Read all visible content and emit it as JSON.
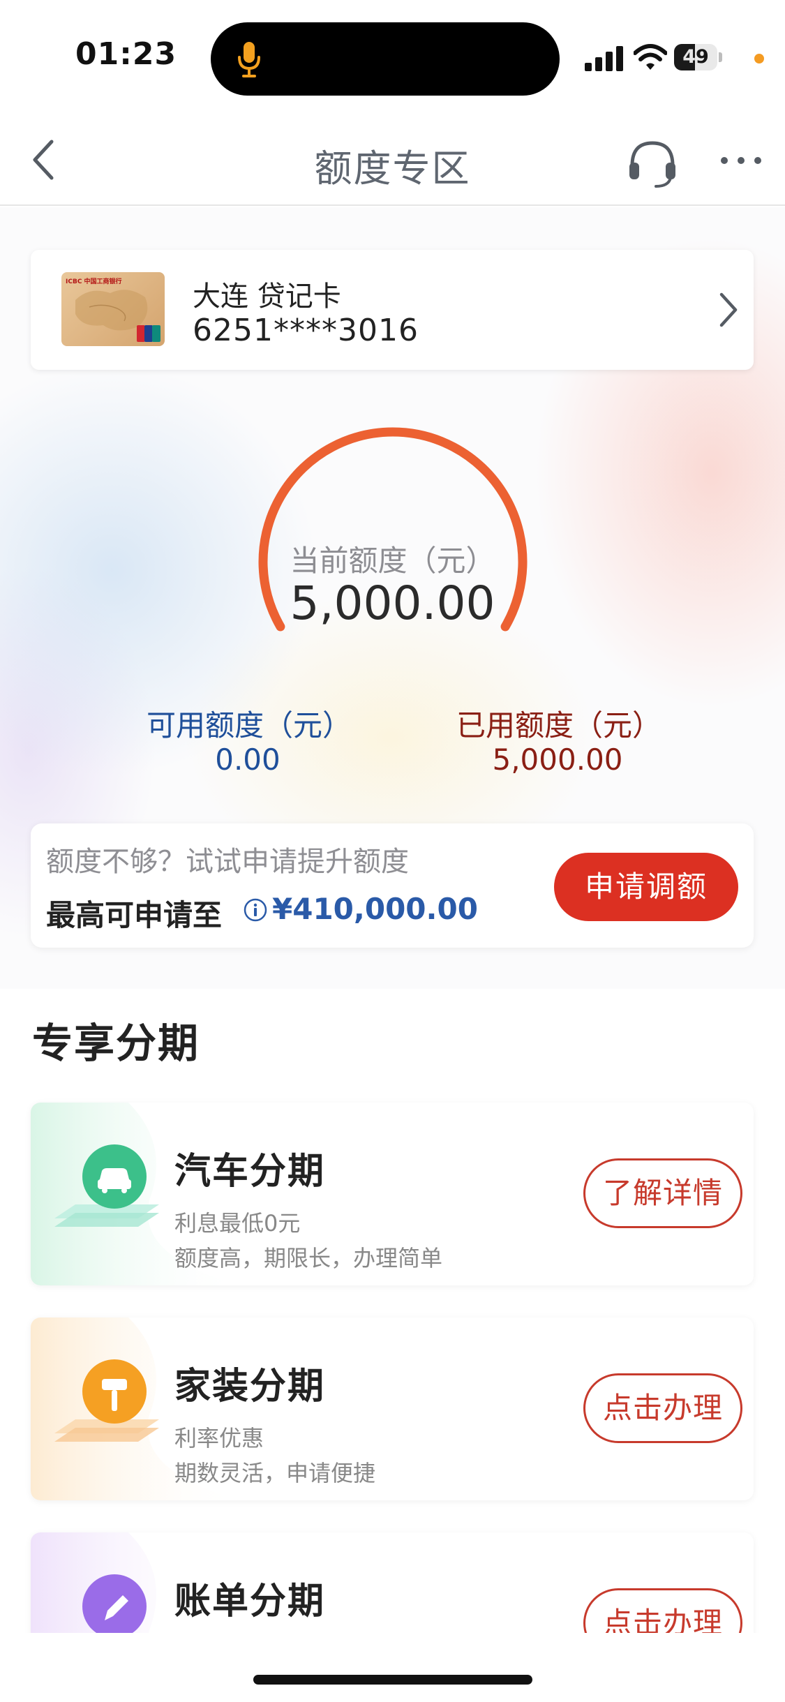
{
  "status_bar": {
    "time": "01:23",
    "battery": "49",
    "battery_level": 0.49,
    "icons": [
      "microphone-icon",
      "signal-icon",
      "wifi-icon",
      "battery-icon"
    ]
  },
  "nav": {
    "title": "额度专区",
    "icons": [
      "back-icon",
      "headset-icon",
      "more-icon"
    ]
  },
  "card": {
    "name": "大连 贷记卡",
    "number": "6251****3016",
    "brand_text": "ICBC 中国工商银行"
  },
  "credit": {
    "current_label": "当前额度（元）",
    "current_value": "5,000.00",
    "available_label": "可用额度（元）",
    "available_value": "0.00",
    "used_label": "已用额度（元）",
    "used_value": "5,000.00",
    "used_fraction": 1.0
  },
  "apply": {
    "prompt": "额度不够？试试申请提升额度",
    "max_label": "最高可申请至",
    "max_value": "¥410,000.00",
    "button": "申请调额"
  },
  "section": {
    "title": "专享分期"
  },
  "products": [
    {
      "title": "汽车分期",
      "line1": "利息最低0元",
      "line2": "额度高，期限长，办理简单",
      "button": "了解详情",
      "icon": "car-icon",
      "color": "#3cc08a"
    },
    {
      "title": "家装分期",
      "line1": "利率优惠",
      "line2": "期数灵活，申请便捷",
      "button": "点击办理",
      "icon": "paint-roller-icon",
      "color": "#f5a023"
    },
    {
      "title": "账单分期",
      "line1": "",
      "line2": "",
      "button": "点击办理",
      "icon": "pencil-icon",
      "color": "#9a6ce8"
    }
  ],
  "colors": {
    "accent_red": "#dc3022",
    "gauge_orange": "#ec6132",
    "available_blue": "#1f4f9a",
    "used_brown": "#8a1f14"
  }
}
